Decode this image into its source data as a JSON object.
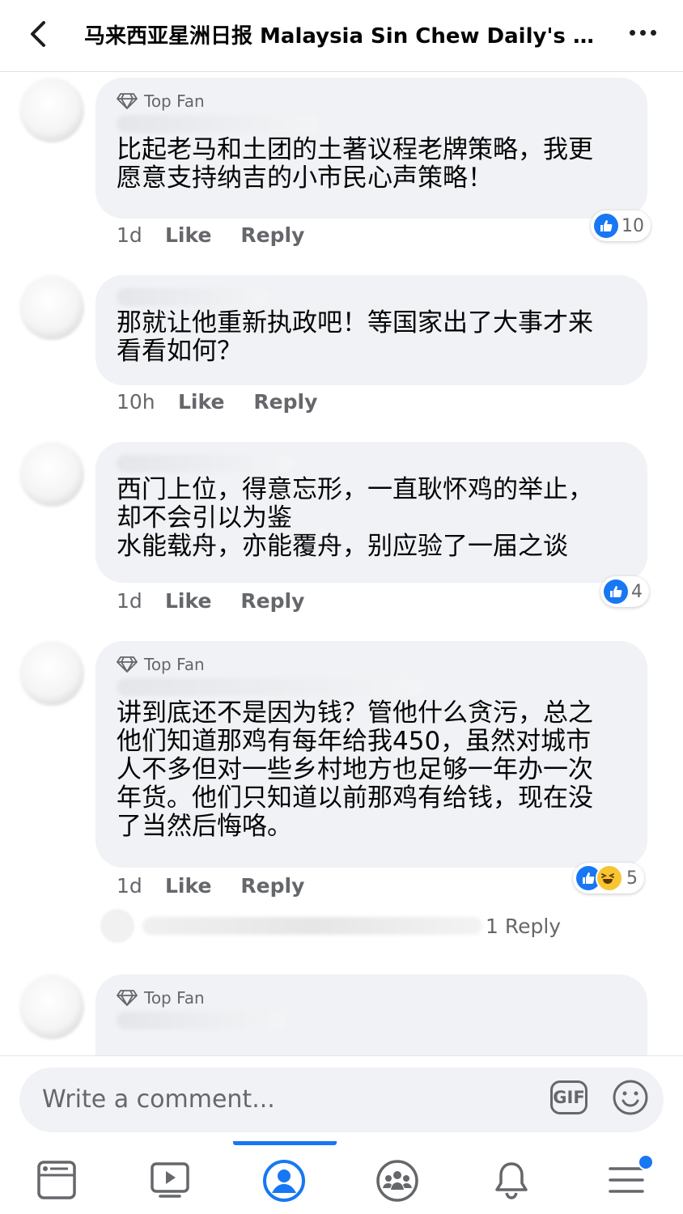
{
  "header": {
    "title": "马来西亚星洲日报 Malaysia Sin Chew Daily's P..."
  },
  "comments": [
    {
      "badge": "Top Fan",
      "text": "比起老马和土团的土著议程老牌策略，我更\n愿意支持纳吉的小市民心声策略！",
      "time": "1d",
      "like_label": "Like",
      "reply_label": "Reply",
      "reaction_count": "10"
    },
    {
      "text": "那就让他重新执政吧！等国家出了大事才来\n看看如何？",
      "time": "10h",
      "like_label": "Like",
      "reply_label": "Reply"
    },
    {
      "text": "西门上位，得意忘形，一直耿怀鸡的举止，\n却不会引以为鉴\n水能载舟，亦能覆舟，别应验了一届之谈",
      "time": "1d",
      "like_label": "Like",
      "reply_label": "Reply",
      "reaction_count": "4"
    },
    {
      "badge": "Top Fan",
      "text": "讲到底还不是因为钱？管他什么贪污，总之\n他们知道那鸡有每年给我450，虽然对城市\n人不多但对一些乡村地方也足够一年办一次\n年货。他们只知道以前那鸡有给钱，现在没\n了当然后悔咯。",
      "time": "1d",
      "like_label": "Like",
      "reply_label": "Reply",
      "reaction_count": "5",
      "replies_label": "1 Reply"
    },
    {
      "badge": "Top Fan"
    }
  ],
  "composer": {
    "placeholder": "Write a comment...",
    "gif_label": "GIF"
  },
  "nav": {
    "items": [
      "news-feed",
      "watch",
      "profile",
      "groups",
      "notifications",
      "menu"
    ],
    "active": "profile"
  },
  "colors": {
    "accent": "#1877f2",
    "bubble": "#f0f2f5",
    "secondary_text": "#65676b"
  }
}
